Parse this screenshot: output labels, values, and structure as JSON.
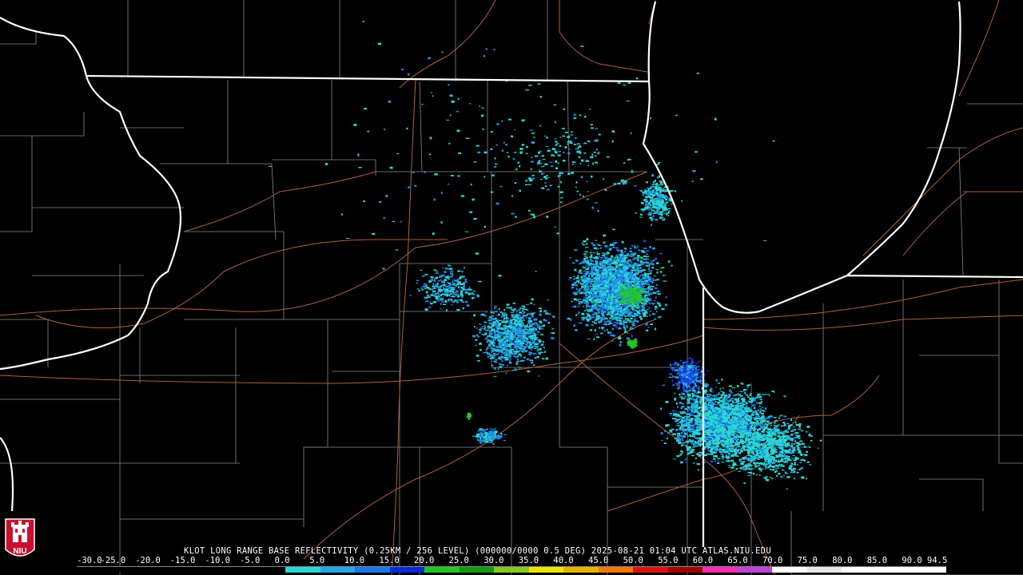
{
  "product_title": "KLOT LONG RANGE BASE REFLECTIVITY (0.25KM / 256 LEVEL) (000000/0000 0.5 DEG) 2025-08-21 01:04 UTC  ATLAS.NIU.EDU",
  "logo_text": "NIU",
  "scale": {
    "labels": [
      "-30.0",
      "-25.0",
      "-20.0",
      "-15.0",
      "-10.0",
      "-5.0",
      "0.0",
      "5.0",
      "10.0",
      "15.0",
      "20.0",
      "25.0",
      "30.0",
      "35.0",
      "40.0",
      "45.0",
      "50.0",
      "55.0",
      "60.0",
      "65.0",
      "70.0",
      "75.0",
      "80.0",
      "85.0",
      "90.0",
      "94.5"
    ],
    "colors": [
      "#000000",
      "#000000",
      "#000000",
      "#000000",
      "#000000",
      "#000000",
      "#2ad6d6",
      "#22a8e6",
      "#1878ee",
      "#0a2ad8",
      "#1ec81e",
      "#109a10",
      "#88c820",
      "#e8e800",
      "#e8b400",
      "#f07800",
      "#e01010",
      "#a00000",
      "#ff2ab4",
      "#c040d8",
      "#ffffff",
      "#e8e8e8",
      "#ffffff",
      "#ffffff",
      "#ffffff"
    ]
  },
  "colors": {
    "background": "#000000",
    "state_border": "#ffffff",
    "county_border": "#8a8a8a",
    "highway": "#b0603a",
    "echo_light_cyan": "#2ad6d6",
    "echo_blue": "#1e90e8",
    "echo_dark_blue": "#1a3ce0",
    "echo_green": "#22c822"
  }
}
